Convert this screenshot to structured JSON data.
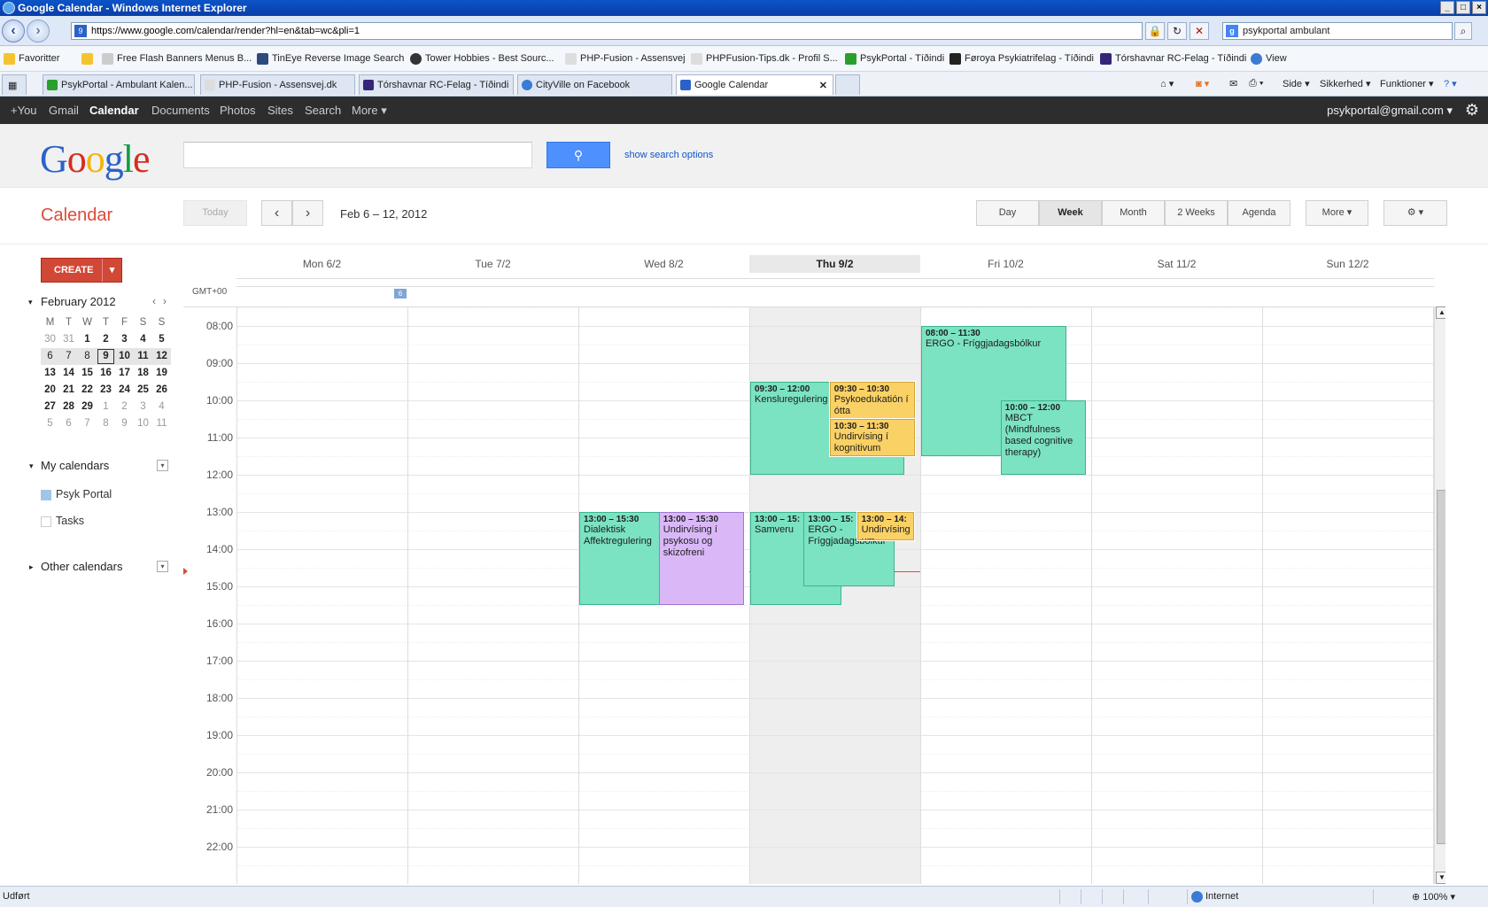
{
  "browser": {
    "title": "Google Calendar - Windows Internet Explorer",
    "url": "https://www.google.com/calendar/render?hl=en&tab=wc&pli=1",
    "search_value": "psykportal ambulant",
    "favorites_label": "Favoritter",
    "favorites": [
      "Free Flash Banners Menus B...",
      "TinEye Reverse Image Search",
      "Tower Hobbies - Best Sourc...",
      "PHP-Fusion - Assensvej",
      "PHPFusion-Tips.dk - Profil S...",
      "PsykPortal - Tíðindi",
      "Føroya Psykiatrifelag - Tíðindi",
      "Tórshavnar RC-Felag - Tíðindi",
      "View"
    ],
    "tabs": [
      "PsykPortal - Ambulant Kalen...",
      "PHP-Fusion - Assensvej.dk",
      "Tórshavnar RC-Felag - Tíðindi",
      "CityVille on Facebook",
      "Google Calendar"
    ],
    "commands": {
      "page": "Side",
      "safety": "Sikkerhed",
      "tools": "Funktioner"
    },
    "status": "Udført",
    "zone": "Internet",
    "zoom": "100%"
  },
  "gbar": {
    "links": [
      "+You",
      "Gmail",
      "Calendar",
      "Documents",
      "Photos",
      "Sites",
      "Search",
      "More ▾"
    ],
    "account": "psykportal@gmail.com ▾"
  },
  "header": {
    "search_placeholder": "",
    "show_search_options": "show search options"
  },
  "toolbar": {
    "app_title": "Calendar",
    "today": "Today",
    "date_range": "Feb 6 – 12, 2012",
    "views": {
      "day": "Day",
      "week": "Week",
      "month": "Month",
      "two_weeks": "2 Weeks",
      "agenda": "Agenda",
      "more": "More ▾"
    }
  },
  "sidebar": {
    "create": "CREATE",
    "minical": {
      "month": "February 2012",
      "weekdays": [
        "M",
        "T",
        "W",
        "T",
        "F",
        "S",
        "S"
      ],
      "weeks": [
        [
          "30",
          "31",
          "1",
          "2",
          "3",
          "4",
          "5"
        ],
        [
          "6",
          "7",
          "8",
          "9",
          "10",
          "11",
          "12"
        ],
        [
          "13",
          "14",
          "15",
          "16",
          "17",
          "18",
          "19"
        ],
        [
          "20",
          "21",
          "22",
          "23",
          "24",
          "25",
          "26"
        ],
        [
          "27",
          "28",
          "29",
          "1",
          "2",
          "3",
          "4"
        ],
        [
          "5",
          "6",
          "7",
          "8",
          "9",
          "10",
          "11"
        ]
      ]
    },
    "my_calendars": "My calendars",
    "calendars": [
      {
        "name": "Psyk Portal",
        "color": "#9fc6e7"
      },
      {
        "name": "Tasks",
        "color": "#ffffff"
      }
    ],
    "other_calendars": "Other calendars"
  },
  "week": {
    "days": [
      "Mon 6/2",
      "Tue 7/2",
      "Wed 8/2",
      "Thu 9/2",
      "Fri 10/2",
      "Sat 11/2",
      "Sun 12/2"
    ],
    "today_index": 3,
    "timezone": "GMT+00",
    "week_number": "6",
    "hours": [
      "08:00",
      "09:00",
      "10:00",
      "11:00",
      "12:00",
      "13:00",
      "14:00",
      "15:00",
      "16:00",
      "17:00",
      "18:00",
      "19:00",
      "20:00",
      "21:00",
      "22:00"
    ],
    "now": "14:35"
  },
  "events": [
    {
      "day": 2,
      "start": "13:00",
      "end": "15:30",
      "time": "13:00 – 15:30",
      "title": "Dialektisk Affektregulering",
      "color": "green",
      "lane": 0,
      "lanes": 2
    },
    {
      "day": 2,
      "start": "13:00",
      "end": "15:30",
      "time": "13:00 – 15:30",
      "title": "Undirvísing í psykosu og skizofreni",
      "color": "purple",
      "lane": 1,
      "lanes": 2
    },
    {
      "day": 3,
      "start": "09:30",
      "end": "12:00",
      "time": "09:30 – 12:00",
      "title": "Kensluregulering",
      "color": "green",
      "lane": 0,
      "lanes": 2,
      "span": 1.8
    },
    {
      "day": 3,
      "start": "09:30",
      "end": "10:30",
      "time": "09:30 – 10:30",
      "title": "Psykoedukatión í ótta",
      "color": "yellow",
      "lane": 1,
      "lanes": 2
    },
    {
      "day": 3,
      "start": "10:30",
      "end": "11:30",
      "time": "10:30 – 11:30",
      "title": "Undirvísing í kognitivum",
      "color": "yellow",
      "lane": 1,
      "lanes": 2
    },
    {
      "day": 3,
      "start": "13:00",
      "end": "15:30",
      "time": "13:00 – 15:",
      "title": "Samveru",
      "color": "green",
      "lane": 0,
      "lanes": 3,
      "span": 1.6
    },
    {
      "day": 3,
      "start": "13:00",
      "end": "15:00",
      "time": "13:00 – 15:",
      "title": "ERGO - Fríggjadagsbólkur",
      "color": "green",
      "lane": 1,
      "lanes": 3,
      "span": 1.6
    },
    {
      "day": 3,
      "start": "13:00",
      "end": "13:45",
      "time": "13:00 – 14:",
      "title": "Undirvísing um",
      "color": "yellow",
      "lane": 2,
      "lanes": 3
    },
    {
      "day": 4,
      "start": "08:00",
      "end": "11:30",
      "time": "08:00 – 11:30",
      "title": "ERGO - Fríggjadagsbólkur",
      "color": "green",
      "lane": 0,
      "lanes": 2,
      "span": 1.7
    },
    {
      "day": 4,
      "start": "10:00",
      "end": "12:00",
      "time": "10:00 – 12:00",
      "title": "MBCT (Mindfulness based cognitive therapy)",
      "color": "green",
      "lane": 1,
      "lanes": 2
    }
  ]
}
